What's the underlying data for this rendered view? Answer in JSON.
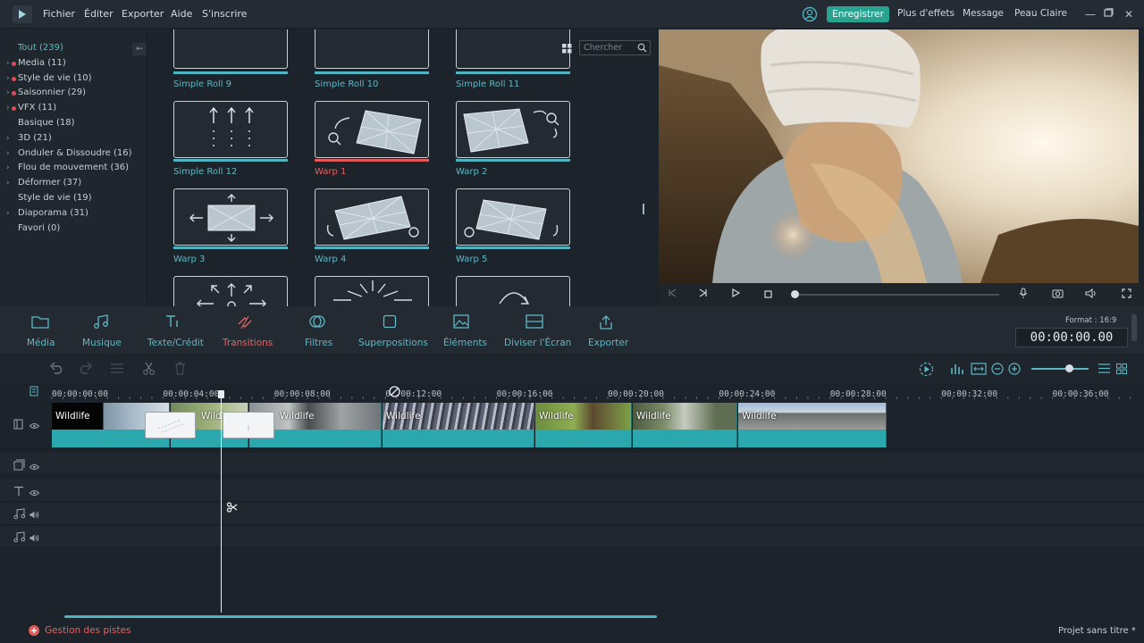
{
  "menu": {
    "items": [
      "Fichier",
      "Éditer",
      "Exporter",
      "Aide",
      "S'inscrire"
    ]
  },
  "topright": {
    "register": "Enregistrer",
    "more_effects": "Plus d'effets",
    "message": "Message",
    "skin": "Peau Claire"
  },
  "categories": [
    {
      "label": "Tout (239)",
      "active": true
    },
    {
      "label": "Media (11)",
      "caret": true,
      "dot": true
    },
    {
      "label": "Style de vie (10)",
      "caret": true,
      "dot": true
    },
    {
      "label": "Saisonnier (29)",
      "caret": true,
      "dot": true
    },
    {
      "label": "VFX (11)",
      "caret": true,
      "dot": true
    },
    {
      "label": "Basique (18)"
    },
    {
      "label": "3D (21)",
      "caret": true
    },
    {
      "label": "Onduler & Dissoudre (16)",
      "caret": true
    },
    {
      "label": "Flou de mouvement (36)",
      "caret": true
    },
    {
      "label": "Déformer (37)",
      "caret": true
    },
    {
      "label": "Style de vie (19)"
    },
    {
      "label": "Diaporama (31)",
      "caret": true
    },
    {
      "label": "Favori (0)"
    }
  ],
  "search": {
    "placeholder": "Chercher"
  },
  "transitions": {
    "row0": [
      "Simple Roll 9",
      "Simple Roll 10",
      "Simple Roll 11"
    ],
    "row1": [
      "Simple Roll 12",
      "Warp 1",
      "Warp 2"
    ],
    "row2": [
      "Warp 3",
      "Warp 4",
      "Warp 5"
    ],
    "selected": "Warp 1"
  },
  "tools": {
    "media": "Média",
    "music": "Musique",
    "text": "Texte/Crédit",
    "transitions": "Transitions",
    "filters": "Filtres",
    "overlays": "Superpositions",
    "elements": "Éléments",
    "split": "Diviser l'Écran",
    "export": "Exporter"
  },
  "format": "Format : 16:9",
  "timecode": "00:00:00.00",
  "ruler": [
    "00:00:00:00",
    "00:00:04:00",
    "00:00:08:00",
    "00:00:12:00",
    "00:00:16:00",
    "00:00:20:00",
    "00:00:24:00",
    "00:00:28:00",
    "00:00:32:00",
    "00:00:36:00"
  ],
  "clips": {
    "title": "Wildlife",
    "short": "Wildl"
  },
  "status": {
    "add_track": "Gestion des pistes",
    "project": "Projet sans titre *"
  },
  "colors": {
    "accent": "#29a38f",
    "teal": "#4fb3c2",
    "red": "#e06464"
  }
}
